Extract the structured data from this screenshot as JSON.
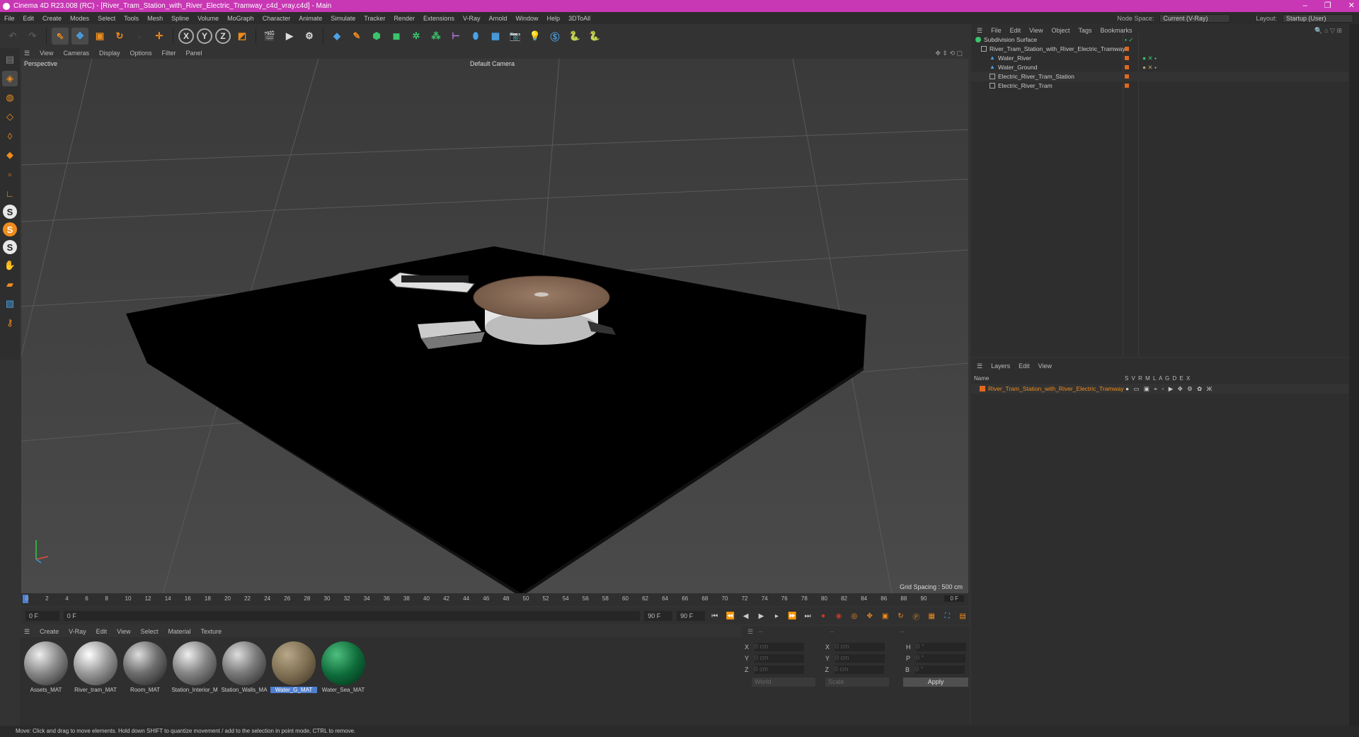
{
  "window": {
    "title": "Cinema 4D R23.008 (RC) - [River_Tram_Station_with_River_Electric_Tramway_c4d_vray.c4d] - Main",
    "controls": [
      "–",
      "❐",
      "✕"
    ]
  },
  "menubar": {
    "items": [
      "File",
      "Edit",
      "Create",
      "Modes",
      "Select",
      "Tools",
      "Mesh",
      "Spline",
      "Volume",
      "MoGraph",
      "Character",
      "Animate",
      "Simulate",
      "Tracker",
      "Render",
      "Extensions",
      "V-Ray",
      "Arnold",
      "Window",
      "Help",
      "3DToAll"
    ],
    "node_space_label": "Node Space:",
    "node_space_value": "Current (V-Ray)",
    "layout_label": "Layout:",
    "layout_value": "Startup (User)"
  },
  "toolbar": {
    "axis_labels": [
      "X",
      "Y",
      "Z"
    ]
  },
  "viewport": {
    "menu": [
      "View",
      "Cameras",
      "Display",
      "Options",
      "Filter",
      "Panel"
    ],
    "projection": "Perspective",
    "camera": "Default Camera",
    "grid_spacing": "Grid Spacing : 500 cm"
  },
  "timeline": {
    "ticks": [
      "0",
      "2",
      "4",
      "6",
      "8",
      "10",
      "12",
      "14",
      "16",
      "18",
      "20",
      "22",
      "24",
      "26",
      "28",
      "30",
      "32",
      "34",
      "36",
      "38",
      "40",
      "42",
      "44",
      "46",
      "48",
      "50",
      "52",
      "54",
      "56",
      "58",
      "60",
      "62",
      "64",
      "66",
      "68",
      "70",
      "72",
      "74",
      "76",
      "78",
      "80",
      "82",
      "84",
      "86",
      "88",
      "90"
    ],
    "current_frame": "0 F",
    "start_field": "0 F",
    "start_field2": "0 F",
    "end_field": "90 F",
    "end_field2": "90 F"
  },
  "material_manager": {
    "menu": [
      "Create",
      "V-Ray",
      "Edit",
      "View",
      "Select",
      "Material",
      "Texture"
    ],
    "materials": [
      {
        "name": "Assets_MAT",
        "color": "#8a8a8a"
      },
      {
        "name": "River_tram_MAT",
        "color": "#9a9a9a"
      },
      {
        "name": "Room_MAT",
        "color": "#6e6e6e"
      },
      {
        "name": "Station_Interior_M",
        "color": "#858585"
      },
      {
        "name": "Station_Walls_MA",
        "color": "#7a7a7a"
      },
      {
        "name": "Water_G_MAT",
        "color": "#7e6e52"
      },
      {
        "name": "Water_Sea_MAT",
        "color": "#0e6b3a"
      }
    ]
  },
  "coordinates": {
    "dashes": [
      "--",
      "--",
      "--"
    ],
    "labels": [
      "X",
      "Y",
      "Z",
      "X",
      "Y",
      "Z",
      "H",
      "P",
      "B"
    ],
    "values": [
      "0 cm",
      "0 cm",
      "0 cm",
      "0 cm",
      "0 cm",
      "0 cm",
      "0 °",
      "0 °",
      "0 °"
    ],
    "mode_world": "World",
    "mode_scale": "Scale",
    "apply": "Apply"
  },
  "object_manager": {
    "menu": [
      "File",
      "Edit",
      "View",
      "Object",
      "Tags",
      "Bookmarks"
    ],
    "objects": [
      {
        "name": "Subdivision Surface",
        "indent": 0
      },
      {
        "name": "River_Tram_Station_with_River_Electric_Tramway",
        "indent": 1
      },
      {
        "name": "Water_River",
        "indent": 2
      },
      {
        "name": "Water_Ground",
        "indent": 2
      },
      {
        "name": "Electric_River_Tram_Station",
        "indent": 2
      },
      {
        "name": "Electric_River_Tram",
        "indent": 2
      }
    ]
  },
  "layer_manager": {
    "menu": [
      "Layers",
      "Edit",
      "View"
    ],
    "header_name": "Name",
    "header_flags": "S V R M L A G D E X",
    "layer": "River_Tram_Station_with_River_Electric_Tramway"
  },
  "status": "Move: Click and drag to move elements. Hold down SHIFT to quantize movement / add to the selection in point mode, CTRL to remove.",
  "colors": {
    "titlebar": "#c837b4",
    "accent_orange": "#f08c1c",
    "selection_blue": "#4f7fd0"
  }
}
